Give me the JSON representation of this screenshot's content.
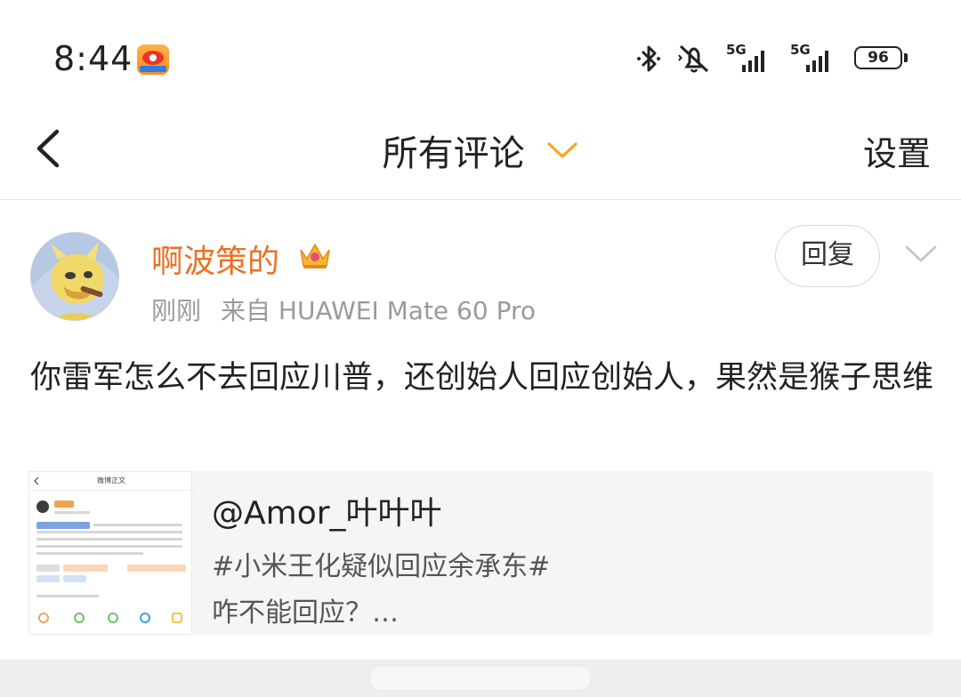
{
  "status_bar": {
    "time": "8:44",
    "app_icon": "weibo-app-icon",
    "network_1": "5G",
    "network_2": "5G",
    "battery": "96",
    "icons": [
      "bluetooth-icon",
      "mute-icon",
      "signal-icon",
      "signal-icon",
      "battery-icon"
    ]
  },
  "header": {
    "back_icon": "chevron-left-icon",
    "title": "所有评论",
    "title_dropdown_icon": "chevron-down-icon",
    "settings_label": "设置",
    "accent_color": "#f5a623"
  },
  "comment": {
    "username": "啊波策的",
    "badge_icon": "crown-icon",
    "time": "刚刚",
    "source": "来自 HUAWEI Mate 60 Pro",
    "reply_label": "回复",
    "more_icon": "chevron-down-icon",
    "text": "你雷军怎么不去回应川普，还创始人回应创始人，果然是猴子思维",
    "username_color": "#ea7125"
  },
  "quoted_post": {
    "author": "@Amor_叶叶叶",
    "line1": "#小米王化疑似回应余承东#",
    "line2": "咋不能回应？…",
    "thumbnail_title": "微博正文"
  }
}
